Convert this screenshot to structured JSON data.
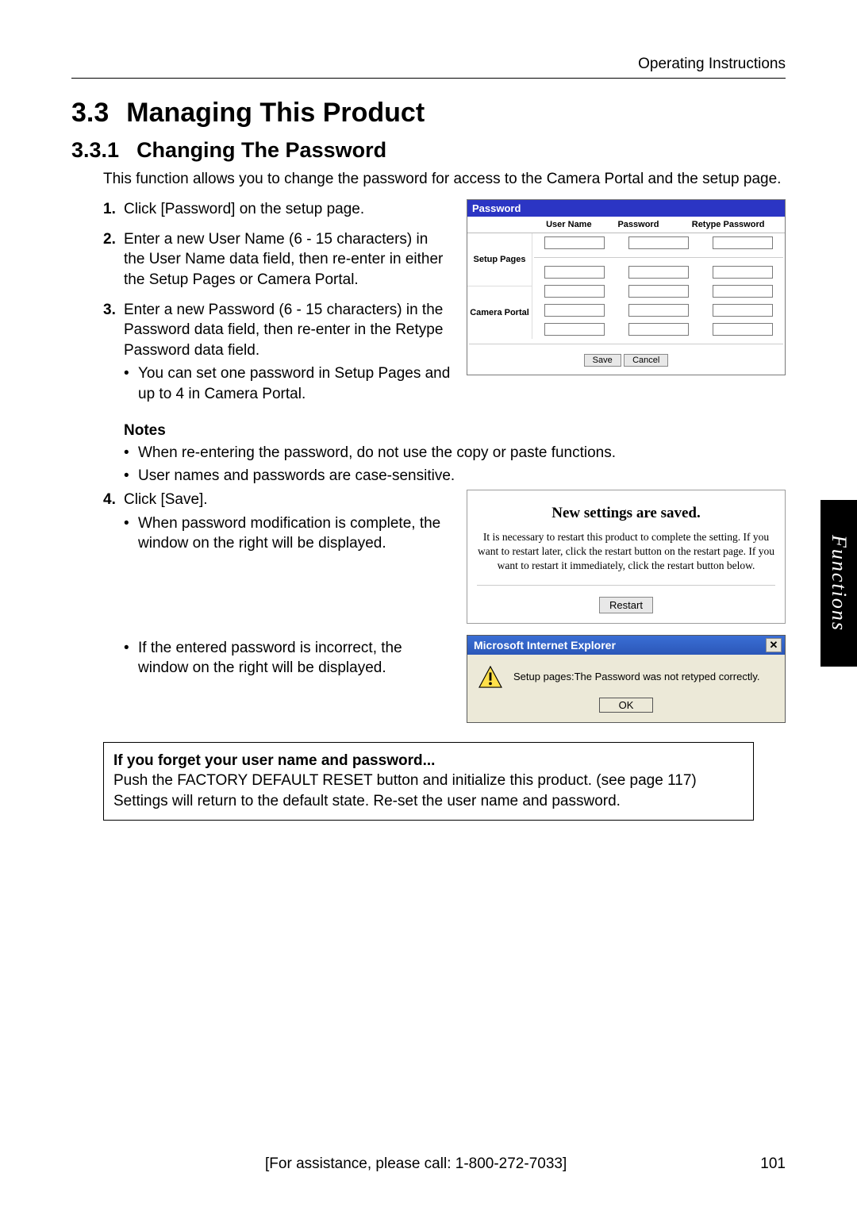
{
  "header": {
    "doc_title": "Operating Instructions"
  },
  "section": {
    "number": "3.3",
    "title": "Managing This Product",
    "sub_number": "3.3.1",
    "sub_title": "Changing The Password",
    "intro": "This function allows you to change the password for access to the Camera Portal and the setup page."
  },
  "steps": {
    "s1": "Click [Password] on the setup page.",
    "s2": "Enter a new User Name (6 - 15 characters) in the User Name data field, then re-enter in either the Setup Pages or Camera Portal.",
    "s3": "Enter a new Password (6 - 15 characters) in the Password data field, then re-enter in the Retype Password data field.",
    "s3_b1": "You can set one password in Setup Pages and up to 4 in Camera Portal.",
    "notes_heading": "Notes",
    "note1": "When re-entering the password, do not use the copy or paste functions.",
    "note2": "User names and passwords are case-sensitive.",
    "s4": "Click [Save].",
    "s4_b1": "When password modification is complete, the window on the right will be displayed.",
    "s4_b2": "If the entered password is incorrect, the window on the right will be displayed."
  },
  "password_panel": {
    "title": "Password",
    "col_user": "User Name",
    "col_pass": "Password",
    "col_retype": "Retype Password",
    "row_setup": "Setup Pages",
    "row_portal": "Camera Portal",
    "save": "Save",
    "cancel": "Cancel"
  },
  "saved_panel": {
    "title": "New settings are saved.",
    "text": "It is necessary to restart this product to complete the setting. If you want to restart later, click the restart button on the restart page. If you want to restart it immediately, click the restart button below.",
    "restart": "Restart"
  },
  "ie_dialog": {
    "title": "Microsoft Internet Explorer",
    "message": "Setup pages:The Password was not retyped correctly.",
    "ok": "OK"
  },
  "forget_box": {
    "title": "If you forget your user name and password...",
    "line1": "Push the FACTORY DEFAULT RESET button and initialize this product. (see page 117)",
    "line2": "Settings will return to the default state. Re-set the user name and password."
  },
  "side_tab": "Functions",
  "footer": {
    "assist": "[For assistance, please call: 1-800-272-7033]",
    "page": "101"
  }
}
